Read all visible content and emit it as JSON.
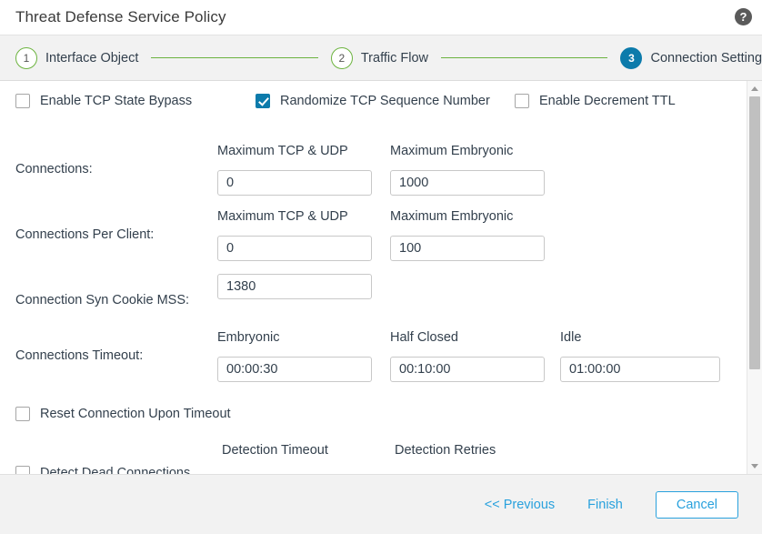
{
  "dialog": {
    "title": "Threat Defense Service Policy",
    "help_icon": "question-mark-circle-icon"
  },
  "stepper": {
    "steps": [
      {
        "number": "1",
        "label": "Interface Object",
        "state": "done"
      },
      {
        "number": "2",
        "label": "Traffic Flow",
        "state": "done"
      },
      {
        "number": "3",
        "label": "Connection Setting",
        "state": "active"
      }
    ],
    "active_color": "#0c7bab",
    "completed_color": "#6cb33f"
  },
  "form": {
    "top_checkboxes": [
      {
        "label": "Enable TCP State Bypass",
        "checked": false
      },
      {
        "label": "Randomize TCP Sequence Number",
        "checked": true
      },
      {
        "label": "Enable Decrement TTL",
        "checked": false
      }
    ],
    "connections": {
      "row_label": "Connections:",
      "col1_header": "Maximum TCP & UDP",
      "col1_value": "0",
      "col2_header": "Maximum Embryonic",
      "col2_value": "1000"
    },
    "connections_per_client": {
      "row_label": "Connections Per Client:",
      "col1_header": "Maximum TCP & UDP",
      "col1_value": "0",
      "col2_header": "Maximum Embryonic",
      "col2_value": "100"
    },
    "syn_cookie": {
      "row_label": "Connection Syn Cookie MSS:",
      "value": "1380"
    },
    "connections_timeout": {
      "row_label": "Connections Timeout:",
      "col1_header": "Embryonic",
      "col1_value": "00:00:30",
      "col2_header": "Half Closed",
      "col2_value": "00:10:00",
      "col3_header": "Idle",
      "col3_value": "01:00:00"
    },
    "reset_connection": {
      "label": "Reset Connection Upon Timeout",
      "checked": false
    },
    "dead_connections": {
      "label": "Detect Dead Connections",
      "checked": false,
      "col1_header": "Detection Timeout",
      "col2_header": "Detection Retries"
    }
  },
  "scrollbar": {
    "up_arrow": "scroll-up-arrow-icon",
    "down_arrow": "scroll-down-arrow-icon"
  },
  "footer": {
    "previous_label": "<< Previous",
    "finish_label": "Finish",
    "cancel_label": "Cancel",
    "accent_color": "#29a1dd"
  }
}
